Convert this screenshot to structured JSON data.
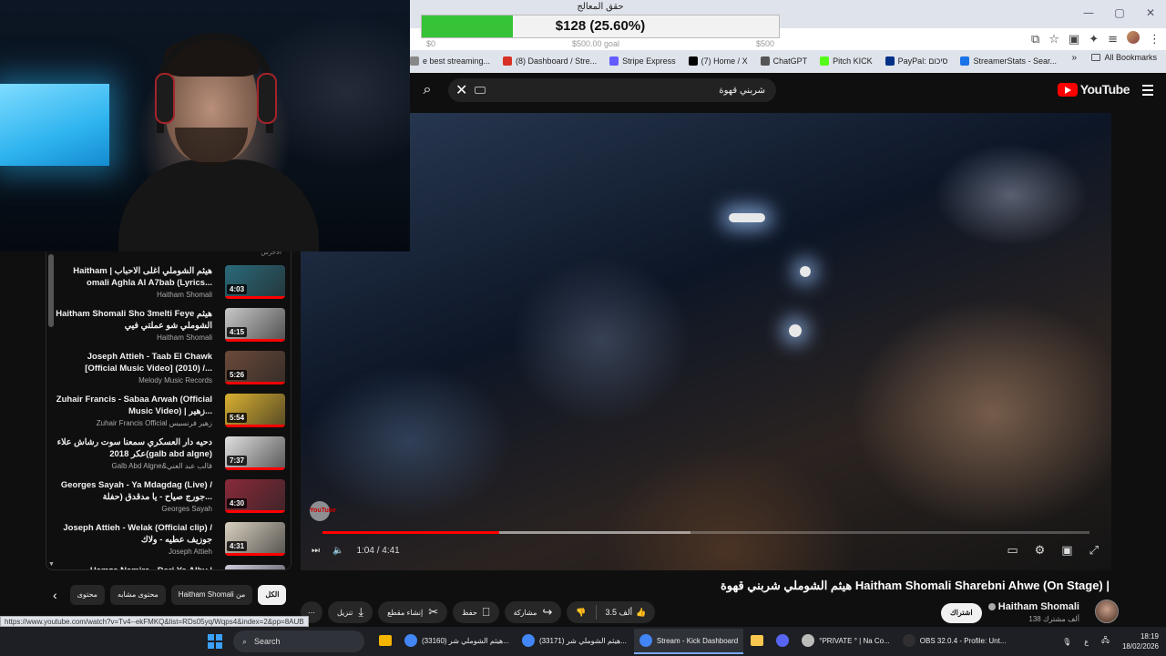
{
  "donation_goal": {
    "title": "حقق المعالج",
    "amount_text": "$128 (25.60%)",
    "progress_percent": 25.6,
    "scale_min": "$0",
    "scale_mid": "$500.00 goal",
    "scale_max": "$500"
  },
  "browser": {
    "window_controls": [
      "—",
      "▢",
      "✕"
    ],
    "toolbar_icons": [
      "cast-icon",
      "star-icon",
      "extension-icon",
      "puzzle-icon",
      "reading-list-icon",
      "profile-icon",
      "menu-icon"
    ],
    "bookmarks": [
      {
        "label": "e best streaming...",
        "color": "#888888"
      },
      {
        "label": "(8) Dashboard / Stre...",
        "color": "#d93025"
      },
      {
        "label": "Stripe Express",
        "color": "#635bff"
      },
      {
        "label": "(7) Home / X",
        "color": "#000000"
      },
      {
        "label": "ChatGPT",
        "color": "#555555"
      },
      {
        "label": "Pitch KICK",
        "color": "#53fc18"
      },
      {
        "label": "PayPal: סיכום",
        "color": "#003087"
      },
      {
        "label": "StreamerStats - Sear...",
        "color": "#1a73e8"
      }
    ],
    "all_bookmarks": "All Bookmarks",
    "status_url": "https://www.youtube.com/watch?v=Tv4--ekFMKQ&list=RDs05yq/Wqps4&index=2&pp=8AUB"
  },
  "youtube": {
    "search_query": "شربني قهوة",
    "logo_text": "YouTube",
    "player": {
      "time_current": "1:04",
      "time_total": "4:41",
      "played_fraction": 0.23,
      "buffered_fraction": 0.48,
      "watermark": "YouTube"
    },
    "video_title": "هيثم الشوملي شربني قهوة Haitham Shomali Sharebni Ahwe (On Stage) |",
    "channel_name": "Haitham Shomali",
    "subscribers": "138 ألف مشترك",
    "subscribe_label": "اشتراك",
    "actions": {
      "like_count": "3.5 ألف",
      "share": "مشاركة",
      "save": "حفظ",
      "clip": "إنشاء مقطع",
      "download": "تنزيل",
      "more": "⋯"
    },
    "chips": [
      "الكل",
      "Haitham Shomali من",
      "محتوى مشابه",
      "محتوى"
    ],
    "playlist_top_label": "الأخرس",
    "playlist": [
      {
        "title": "Haitham | هيثم الشوملي اغلى الاحباب omali Aghla Al A7bab (Lyrics...",
        "channel": "Haitham Shomali",
        "duration": "4:03",
        "thumb": "#2a6a7a"
      },
      {
        "title": "Haitham Shomali Sho 3melti Feye هيثم الشوملي شو عملتي فيي",
        "channel": "Haitham Shomali",
        "duration": "4:15",
        "thumb": "#c8c8c8"
      },
      {
        "title": "Joseph Attieh - Taab El Chawk [Official Music Video] (2010) /...",
        "channel": "Melody Music Records",
        "duration": "5:26",
        "thumb": "#6b4a3a"
      },
      {
        "title": "Zuhair Francis - Sabaa Arwah (Official Music Video) | زهير...",
        "channel": "Zuhair Francis Official زهير فرنسيس",
        "duration": "5:54",
        "thumb": "#d9b030"
      },
      {
        "title": "دحيه دار العسكري سمعنا سوت رشاش علاء عكر 2018(galb abd algne)",
        "channel": "Galb Abd Algne&قالب عبد الغني",
        "duration": "7:37",
        "thumb": "#e0e0e0"
      },
      {
        "title": "Georges Sayah - Ya Mdagdag (Live) / جورج صياح - يا مدقدق (حفلة...",
        "channel": "Georges Sayah",
        "duration": "4:30",
        "thumb": "#8a2a3a"
      },
      {
        "title": "Joseph Attieh - Welak (Official clip) / جوزيف عطيه - ولاك",
        "channel": "Joseph Attieh",
        "duration": "4:31",
        "thumb": "#d8d0c0"
      },
      {
        "title": "Hamza Namira - Dari Ya Alby |",
        "channel": "",
        "duration": "",
        "thumb": "#ccccdd"
      }
    ]
  },
  "taskbar": {
    "search_label": "Search",
    "apps": [
      {
        "label": "",
        "kind": "files",
        "color": "#f4b400",
        "active": false
      },
      {
        "label": "(33160) هيثم الشوملي شر...",
        "kind": "chrome",
        "color": "#4285f4",
        "active": false
      },
      {
        "label": "(33171) هيثم الشوملي شر...",
        "kind": "chrome",
        "color": "#4285f4",
        "active": false
      },
      {
        "label": "Stream - Kick Dashboard",
        "kind": "chrome",
        "color": "#4285f4",
        "active": true
      },
      {
        "label": "",
        "kind": "explorer",
        "color": "#f9c74f",
        "active": false
      },
      {
        "label": "",
        "kind": "discord",
        "color": "#5865f2",
        "active": false
      },
      {
        "label": "°PRIVATE ° | Na Co...",
        "kind": "lock",
        "color": "#bbbbbb",
        "active": false
      },
      {
        "label": "OBS 32.0.4 - Profile: Unt...",
        "kind": "obs",
        "color": "#302e31",
        "active": false
      }
    ],
    "tray_lang": "ع",
    "time": "18:19",
    "date": "18/02/2026"
  }
}
